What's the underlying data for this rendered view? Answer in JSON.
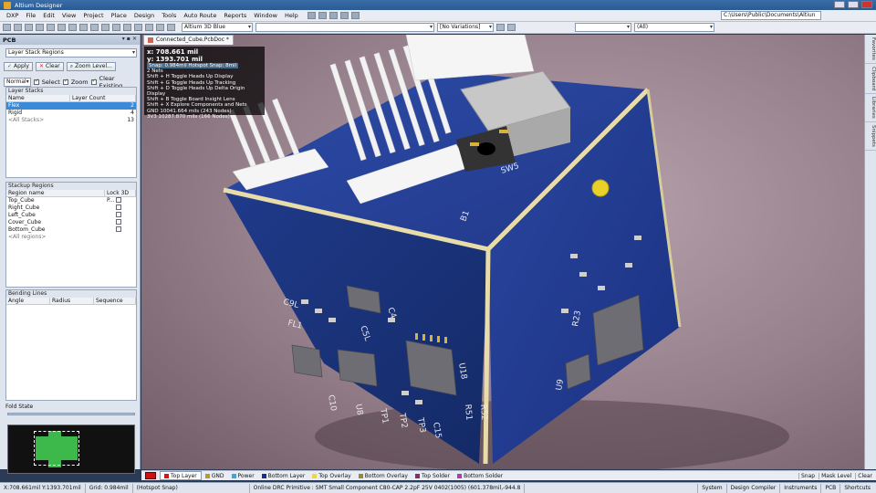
{
  "window": {
    "title": "Altium Designer"
  },
  "menu": {
    "items": [
      "DXP",
      "File",
      "Edit",
      "View",
      "Project",
      "Place",
      "Design",
      "Tools",
      "Auto Route",
      "Reports",
      "Window",
      "Help"
    ]
  },
  "path_box": "C:\\Users\\Public\\Documents\\Altiun",
  "toolbar": {
    "view_config": "Altium 3D Blue",
    "variations": "[No Variations]",
    "all_filter": "(All)"
  },
  "panel": {
    "title": "PCB",
    "mode_select": "Layer Stack Regions",
    "apply_label": "Apply",
    "clear_label": "Clear",
    "zoom_level_label": "Zoom Level...",
    "normal_select": "Normal",
    "select_label": "Select",
    "zoom_label": "Zoom",
    "clear_existing_label": "Clear Existing",
    "layer_stacks": {
      "title": "Layer Stacks",
      "headers": [
        "Name",
        "Layer Count"
      ],
      "rows": [
        {
          "name": "Flex",
          "count": "2"
        },
        {
          "name": "Rigid",
          "count": "4"
        },
        {
          "name": "<All Stacks>",
          "count": "13"
        }
      ]
    },
    "stackup_regions": {
      "title": "Stackup Regions",
      "headers": [
        "Region name",
        "Lock 3D P..."
      ],
      "rows": [
        "Top_Cube",
        "Right_Cube",
        "Left_Cube",
        "Cover_Cube",
        "Bottom_Cube",
        "<All regions>"
      ]
    },
    "bending_lines": {
      "title": "Bending Lines",
      "headers": [
        "Angle",
        "Radius",
        "Sequence"
      ]
    },
    "fold_state": {
      "title": "Fold State"
    }
  },
  "doc_tab": {
    "label": "Connected_Cube.PcbDoc *"
  },
  "hud": {
    "x": "x: 708.661 mil",
    "y": "y: 1393.701 mil",
    "snap": "Snap: 0.984mil Hotspot Snap: 8mil",
    "nets": "2 Nets",
    "lines": [
      "Shift + H  Toggle Heads Up Display",
      "Shift + G  Toggle Heads Up Tracking",
      "Shift + D  Toggle Heads Up Delta Origin Display",
      "Shift + B  Toggle Board Insight Lens",
      "Shift + X  Explore Components and Nets"
    ],
    "net1": "GND   10041.664 mils (243 Nodes)",
    "net2": "3V3   10287.870 mils (166 Nodes)"
  },
  "right_tabs": [
    "Favorites",
    "Clipboard",
    "Libraries",
    "Snippets"
  ],
  "layers": {
    "items": [
      {
        "label": "Top Layer",
        "color": "#cc1a1a"
      },
      {
        "label": "GND",
        "color": "#b89a2a"
      },
      {
        "label": "Power",
        "color": "#4aa0d0"
      },
      {
        "label": "Bottom Layer",
        "color": "#1a2a9a"
      },
      {
        "label": "Top Overlay",
        "color": "#e8d84a"
      },
      {
        "label": "Bottom Overlay",
        "color": "#9a8a2a"
      },
      {
        "label": "Top Solder",
        "color": "#8a2a6a"
      },
      {
        "label": "Bottom Solder",
        "color": "#b03ab0"
      }
    ],
    "right": [
      "Snap",
      "Mask Level",
      "Clear"
    ]
  },
  "status": {
    "coords": "X:708.661mil Y:1393.701mil",
    "grid": "Grid: 0.984mil",
    "snap": "(Hotspot Snap)",
    "message": "Online DRC Primitive : SMT Small Component C80-CAP 2.2pF 25V 0402(1005) (601.378mil,-944.8",
    "right": [
      "System",
      "Design Compiler",
      "Instruments",
      "PCB",
      "Shortcuts"
    ]
  },
  "pcb_silk": [
    "C9L",
    "FL1",
    "C5L",
    "C4",
    "U18",
    "U8",
    "TP1",
    "TP2",
    "TP3",
    "R51",
    "R52",
    "C10",
    "C15",
    "SW5",
    "B1",
    "U9",
    "R23"
  ]
}
